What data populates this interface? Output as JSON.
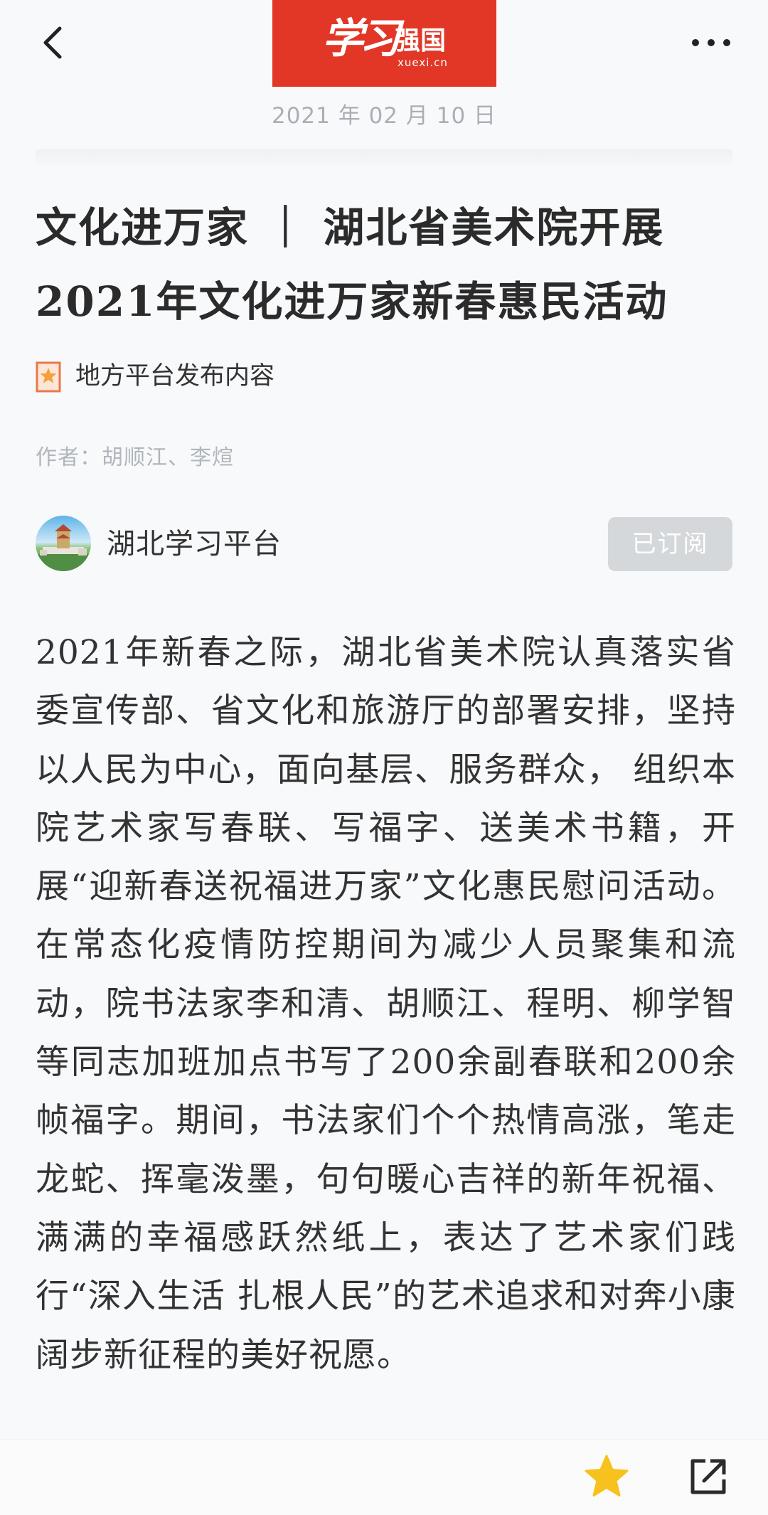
{
  "header": {
    "back_icon": "chevron-left-icon",
    "logo": {
      "script_text": "学习",
      "brand_text": "强国",
      "domain": "xuexi.cn",
      "color": "#e23726"
    },
    "more_icon": "more-horizontal-icon",
    "date": "2021 年 02 月 10 日"
  },
  "article": {
    "title": "文化进万家 ｜ 湖北省美术院开展2021年文化进万家新春惠民活动",
    "source_icon": "star-badge-icon",
    "source_label": "地方平台发布内容",
    "author": "作者：胡顺江、李煊",
    "channel": {
      "name": "湖北学习平台",
      "subscribe_label": "已订阅"
    },
    "body": "2021年新春之际，湖北省美术院认真落实省委宣传部、省文化和旅游厅的部署安排，坚持以人民为中心，面向基层、服务群众， 组织本院艺术家写春联、写福字、送美术书籍，开展“迎新春送祝福进万家”文化惠民慰问活动。在常态化疫情防控期间为减少人员聚集和流动，院书法家李和清、胡顺江、程明、柳学智等同志加班加点书写了200余副春联和200余帧福字。期间，书法家们个个热情高涨，笔走龙蛇、挥毫泼墨，句句暖心吉祥的新年祝福、满满的幸福感跃然纸上，表达了艺术家们践行“深入生活 扎根人民”的艺术追求和对奔小康阔步新征程的美好祝愿。"
  },
  "footer": {
    "favorite_icon": "star-icon",
    "favorite_color": "#f7c21e",
    "share_icon": "share-external-icon"
  },
  "colors": {
    "brand_red": "#e23726",
    "background": "#f8f9fb",
    "subscribe_button": "#d5d8db"
  }
}
